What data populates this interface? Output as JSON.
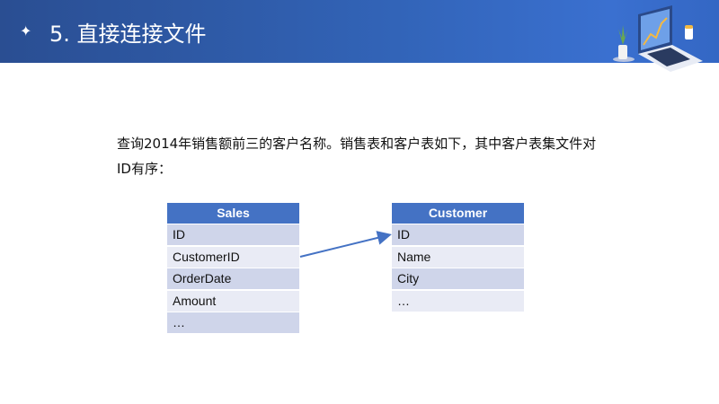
{
  "header": {
    "bullet_icon": "sparkle-icon",
    "title": "5. 直接连接文件",
    "illustration": "laptop-chart-icon"
  },
  "body": {
    "text": "查询2014年销售额前三的客户名称。销售表和客户表如下，其中客户表集文件对ID有序："
  },
  "sales_table": {
    "title": "Sales",
    "rows": [
      "ID",
      "CustomerID",
      "OrderDate",
      "Amount",
      "…"
    ]
  },
  "customer_table": {
    "title": "Customer",
    "rows": [
      "ID",
      "Name",
      "City",
      "…"
    ]
  },
  "colors": {
    "header": "#4472c4",
    "row_dark": "#cfd5ea",
    "row_light": "#e9ebf5",
    "arrow": "#4472c4"
  }
}
